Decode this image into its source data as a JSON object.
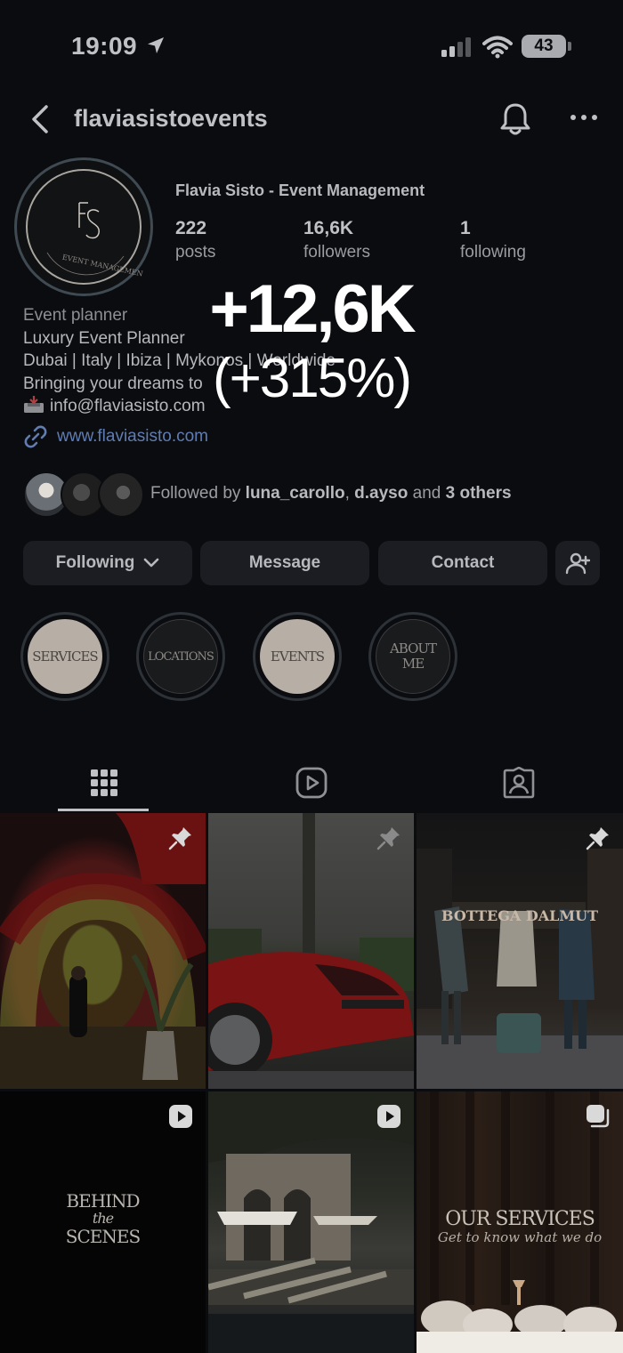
{
  "status": {
    "time": "19:09",
    "battery": "43"
  },
  "header": {
    "username": "flaviasistoevents"
  },
  "profile": {
    "avatar_logo": "FS",
    "display_name": "Flavia Sisto - Event Management",
    "stats": [
      {
        "value": "222",
        "label": "posts"
      },
      {
        "value": "16,6K",
        "label": "followers"
      },
      {
        "value": "1",
        "label": "following"
      }
    ],
    "bio": {
      "category": "Event planner",
      "line1": "Luxury Event Planner",
      "line2": "Dubai | Italy | Ibiza | Mykonos | Worldwide",
      "line3": "Bringing your dreams to",
      "email": "info@flaviasisto.com",
      "website": "www.flaviasisto.com"
    }
  },
  "overlay": {
    "headline": "+12,6K",
    "subline": "(+315%)"
  },
  "followed_by": {
    "prefix": "Followed by ",
    "user1": "luna_carollo",
    "separator": ", ",
    "user2": "d.ayso",
    "conjunction": " and ",
    "others": "3 others"
  },
  "actions": {
    "following": "Following",
    "message": "Message",
    "contact": "Contact"
  },
  "highlights": [
    {
      "label": "SERVICES"
    },
    {
      "label": "LOCATIONS"
    },
    {
      "label": "EVENTS"
    },
    {
      "label": "ABOUT ME"
    }
  ],
  "tabs": {
    "active": "grid",
    "icons": [
      "grid-icon",
      "reels-icon",
      "tagged-icon"
    ]
  },
  "grid_posts": [
    {
      "type": "pinned"
    },
    {
      "type": "pinned"
    },
    {
      "type": "pinned",
      "sign": "BOTTEGA DALMUT"
    },
    {
      "type": "reel",
      "title_line1": "BEHIND",
      "title_line2": "the",
      "title_line3": "SCENES"
    },
    {
      "type": "reel"
    },
    {
      "type": "carousel",
      "title": "OUR SERVICES",
      "subtitle": "Get to know what we do"
    }
  ],
  "colors": {
    "background": "#0b0c0f",
    "button": "#1b1d22",
    "link": "#5f7db2",
    "overlay_text": "#ffffff"
  }
}
